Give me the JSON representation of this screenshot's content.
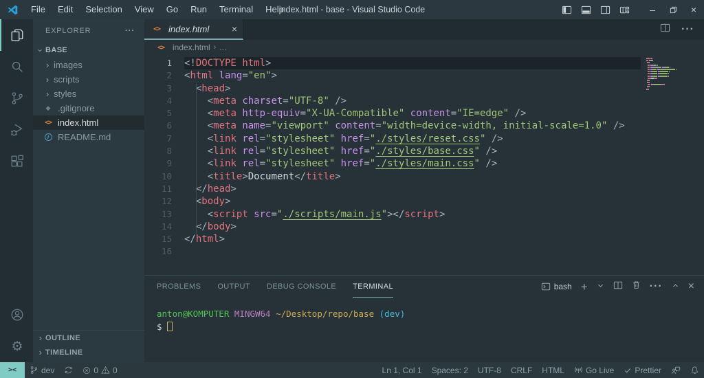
{
  "window_title": "index.html - base - Visual Studio Code",
  "menu": [
    "File",
    "Edit",
    "Selection",
    "View",
    "Go",
    "Run",
    "Terminal",
    "Help"
  ],
  "activity_bar": {
    "items": [
      "explorer",
      "search",
      "source-control",
      "run-and-debug",
      "extensions"
    ],
    "bottom": [
      "accounts",
      "settings"
    ]
  },
  "sidebar": {
    "title": "EXPLORER",
    "section": "BASE",
    "items": [
      {
        "label": "images",
        "kind": "folder"
      },
      {
        "label": "scripts",
        "kind": "folder"
      },
      {
        "label": "styles",
        "kind": "folder"
      },
      {
        "label": ".gitignore",
        "kind": "git"
      },
      {
        "label": "index.html",
        "kind": "html",
        "selected": true
      },
      {
        "label": "README.md",
        "kind": "info"
      }
    ],
    "bottom_sections": [
      "OUTLINE",
      "TIMELINE"
    ]
  },
  "editor": {
    "tab": {
      "label": "index.html"
    },
    "breadcrumb": {
      "file": "index.html",
      "more": "..."
    },
    "lines": [
      {
        "n": 1,
        "active": true,
        "tokens": [
          [
            "p",
            "<!"
          ],
          [
            "t",
            "DOCTYPE"
          ],
          [
            "w",
            " "
          ],
          [
            "t",
            "html"
          ],
          [
            "p",
            ">"
          ]
        ]
      },
      {
        "n": 2,
        "tokens": [
          [
            "p",
            "<"
          ],
          [
            "t",
            "html"
          ],
          [
            "w",
            " "
          ],
          [
            "a",
            "lang"
          ],
          [
            "p",
            "="
          ],
          [
            "s",
            "\"en\""
          ],
          [
            "p",
            ">"
          ]
        ]
      },
      {
        "n": 3,
        "tokens": [
          [
            "w",
            "  "
          ],
          [
            "p",
            "<"
          ],
          [
            "t",
            "head"
          ],
          [
            "p",
            ">"
          ]
        ]
      },
      {
        "n": 4,
        "tokens": [
          [
            "w",
            "    "
          ],
          [
            "p",
            "<"
          ],
          [
            "t",
            "meta"
          ],
          [
            "w",
            " "
          ],
          [
            "a",
            "charset"
          ],
          [
            "p",
            "="
          ],
          [
            "s",
            "\"UTF-8\""
          ],
          [
            "w",
            " "
          ],
          [
            "p",
            "/>"
          ]
        ]
      },
      {
        "n": 5,
        "tokens": [
          [
            "w",
            "    "
          ],
          [
            "p",
            "<"
          ],
          [
            "t",
            "meta"
          ],
          [
            "w",
            " "
          ],
          [
            "a",
            "http-equiv"
          ],
          [
            "p",
            "="
          ],
          [
            "s",
            "\"X-UA-Compatible\""
          ],
          [
            "w",
            " "
          ],
          [
            "a",
            "content"
          ],
          [
            "p",
            "="
          ],
          [
            "s",
            "\"IE=edge\""
          ],
          [
            "w",
            " "
          ],
          [
            "p",
            "/>"
          ]
        ]
      },
      {
        "n": 6,
        "tokens": [
          [
            "w",
            "    "
          ],
          [
            "p",
            "<"
          ],
          [
            "t",
            "meta"
          ],
          [
            "w",
            " "
          ],
          [
            "a",
            "name"
          ],
          [
            "p",
            "="
          ],
          [
            "s",
            "\"viewport\""
          ],
          [
            "w",
            " "
          ],
          [
            "a",
            "content"
          ],
          [
            "p",
            "="
          ],
          [
            "s",
            "\"width=device-width, initial-scale=1.0\""
          ],
          [
            "w",
            " "
          ],
          [
            "p",
            "/>"
          ]
        ]
      },
      {
        "n": 7,
        "tokens": [
          [
            "w",
            "    "
          ],
          [
            "p",
            "<"
          ],
          [
            "t",
            "link"
          ],
          [
            "w",
            " "
          ],
          [
            "a",
            "rel"
          ],
          [
            "p",
            "="
          ],
          [
            "s",
            "\"stylesheet\""
          ],
          [
            "w",
            " "
          ],
          [
            "a",
            "href"
          ],
          [
            "p",
            "="
          ],
          [
            "s",
            "\""
          ],
          [
            "u",
            "./styles/reset.css"
          ],
          [
            "s",
            "\""
          ],
          [
            "w",
            " "
          ],
          [
            "p",
            "/>"
          ]
        ]
      },
      {
        "n": 8,
        "tokens": [
          [
            "w",
            "    "
          ],
          [
            "p",
            "<"
          ],
          [
            "t",
            "link"
          ],
          [
            "w",
            " "
          ],
          [
            "a",
            "rel"
          ],
          [
            "p",
            "="
          ],
          [
            "s",
            "\"stylesheet\""
          ],
          [
            "w",
            " "
          ],
          [
            "a",
            "href"
          ],
          [
            "p",
            "="
          ],
          [
            "s",
            "\""
          ],
          [
            "u",
            "./styles/base.css"
          ],
          [
            "s",
            "\""
          ],
          [
            "w",
            " "
          ],
          [
            "p",
            "/>"
          ]
        ]
      },
      {
        "n": 9,
        "tokens": [
          [
            "w",
            "    "
          ],
          [
            "p",
            "<"
          ],
          [
            "t",
            "link"
          ],
          [
            "w",
            " "
          ],
          [
            "a",
            "rel"
          ],
          [
            "p",
            "="
          ],
          [
            "s",
            "\"stylesheet\""
          ],
          [
            "w",
            " "
          ],
          [
            "a",
            "href"
          ],
          [
            "p",
            "="
          ],
          [
            "s",
            "\""
          ],
          [
            "u",
            "./styles/main.css"
          ],
          [
            "s",
            "\""
          ],
          [
            "w",
            " "
          ],
          [
            "p",
            "/>"
          ]
        ]
      },
      {
        "n": 10,
        "tokens": [
          [
            "w",
            "    "
          ],
          [
            "p",
            "<"
          ],
          [
            "t",
            "title"
          ],
          [
            "p",
            ">"
          ],
          [
            "w",
            "Document"
          ],
          [
            "p",
            "</"
          ],
          [
            "t",
            "title"
          ],
          [
            "p",
            ">"
          ]
        ]
      },
      {
        "n": 11,
        "tokens": [
          [
            "w",
            "  "
          ],
          [
            "p",
            "</"
          ],
          [
            "t",
            "head"
          ],
          [
            "p",
            ">"
          ]
        ]
      },
      {
        "n": 12,
        "tokens": [
          [
            "w",
            "  "
          ],
          [
            "p",
            "<"
          ],
          [
            "t",
            "body"
          ],
          [
            "p",
            ">"
          ]
        ]
      },
      {
        "n": 13,
        "tokens": [
          [
            "w",
            "    "
          ],
          [
            "p",
            "<"
          ],
          [
            "t",
            "script"
          ],
          [
            "w",
            " "
          ],
          [
            "a",
            "src"
          ],
          [
            "p",
            "="
          ],
          [
            "s",
            "\""
          ],
          [
            "u",
            "./scripts/main.js"
          ],
          [
            "s",
            "\""
          ],
          [
            "p",
            ">"
          ],
          [
            "p",
            "</"
          ],
          [
            "t",
            "script"
          ],
          [
            "p",
            ">"
          ]
        ]
      },
      {
        "n": 14,
        "tokens": [
          [
            "w",
            "  "
          ],
          [
            "p",
            "</"
          ],
          [
            "t",
            "body"
          ],
          [
            "p",
            ">"
          ]
        ]
      },
      {
        "n": 15,
        "tokens": [
          [
            "p",
            "</"
          ],
          [
            "t",
            "html"
          ],
          [
            "p",
            ">"
          ]
        ]
      },
      {
        "n": 16,
        "tokens": []
      }
    ]
  },
  "panel": {
    "tabs": [
      {
        "label": "PROBLEMS"
      },
      {
        "label": "OUTPUT"
      },
      {
        "label": "DEBUG CONSOLE"
      },
      {
        "label": "TERMINAL",
        "active": true
      }
    ],
    "shell_label": "bash",
    "terminal": [
      {
        "tokens": [
          [
            "tg",
            "anton@KOMPUTER"
          ],
          [
            "tw",
            " "
          ],
          [
            "tm",
            "MINGW64"
          ],
          [
            "tw",
            " "
          ],
          [
            "ty",
            "~/Desktop/repo/base"
          ],
          [
            "tw",
            " "
          ],
          [
            "tc",
            "(dev)"
          ]
        ]
      },
      {
        "tokens": [
          [
            "tw",
            "$ "
          ],
          [
            "cur",
            ""
          ]
        ]
      }
    ]
  },
  "status_bar": {
    "branch": "dev",
    "errors": "0",
    "warnings": "0",
    "right": [
      {
        "name": "cursor-position",
        "label": "Ln 1, Col 1"
      },
      {
        "name": "indentation",
        "label": "Spaces: 2"
      },
      {
        "name": "encoding",
        "label": "UTF-8"
      },
      {
        "name": "eol",
        "label": "CRLF"
      },
      {
        "name": "language-mode",
        "label": "HTML"
      },
      {
        "name": "go-live",
        "label": "Go Live",
        "icon": "broadcast"
      },
      {
        "name": "prettier",
        "label": "Prettier",
        "icon": "check"
      },
      {
        "name": "feedback",
        "label": "",
        "icon": "feedback"
      },
      {
        "name": "notifications",
        "label": "",
        "icon": "bell"
      }
    ]
  },
  "colors": {
    "accent_teal": "#80cbc4",
    "tab_underline": "#76a8ab",
    "tag_red": "#e2737c",
    "attr_purple": "#c792ea",
    "string_green": "#a3c57a",
    "html_icon_orange": "#e0823d",
    "info_blue": "#519aba",
    "terminal_green": "#55c155",
    "terminal_magenta": "#bd7ebe",
    "terminal_yellow": "#ccac51",
    "terminal_cyan": "#46b9d8"
  }
}
